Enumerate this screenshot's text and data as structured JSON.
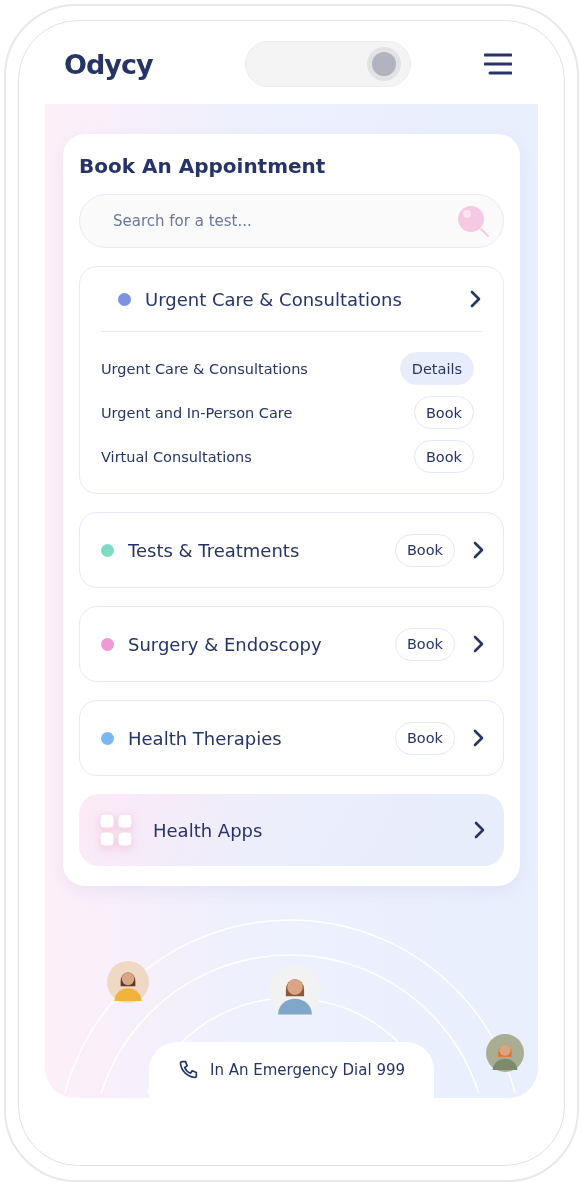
{
  "header": {
    "logo": "Odycy"
  },
  "booking": {
    "title": "Book An Appointment",
    "search": {
      "placeholder": "Search for a test..."
    },
    "categories": [
      {
        "name": "Urgent Care & Consultations",
        "color": "#7b93e0",
        "expanded": true,
        "children": [
          {
            "name": "Urgent Care & Consultations",
            "kind": "details",
            "action": "Details"
          },
          {
            "name": "Urgent and In-Person Care",
            "kind": "book",
            "action": "Book"
          },
          {
            "name": "Virtual Consultations",
            "kind": "book",
            "action": "Book"
          }
        ]
      },
      {
        "name": "Tests & Treatments",
        "color": "#7fdcc4",
        "expanded": false,
        "action": "Book"
      },
      {
        "name": "Surgery & Endoscopy",
        "color": "#ee9ad8",
        "expanded": false,
        "action": "Book"
      },
      {
        "name": "Health Therapies",
        "color": "#7ab8f5",
        "expanded": false,
        "action": "Book"
      }
    ],
    "apps": {
      "label": "Health Apps"
    }
  },
  "emergency": {
    "label": "In An Emergency Dial 999"
  }
}
